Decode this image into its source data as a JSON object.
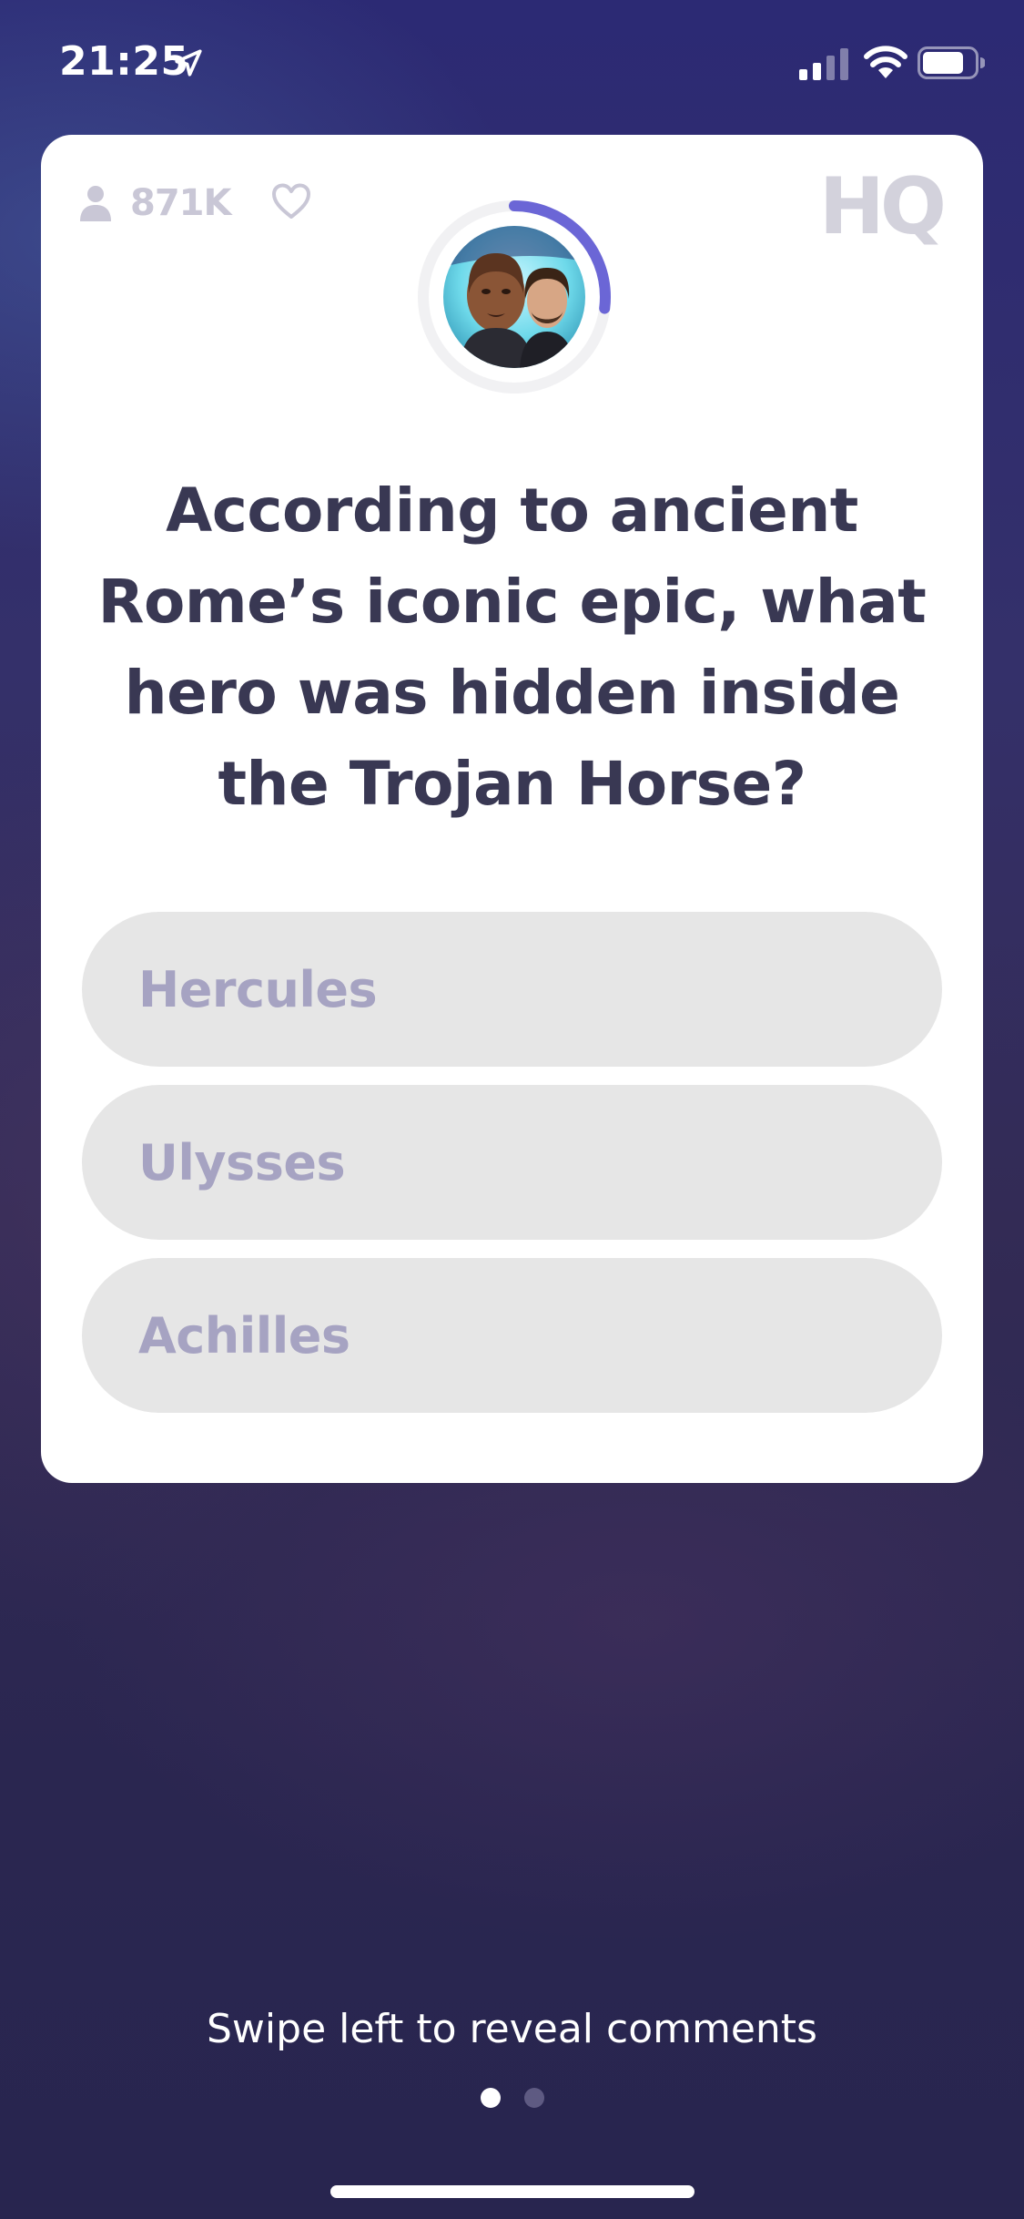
{
  "status_bar": {
    "time": "21:25",
    "icons": [
      "location-arrow-icon",
      "cellular-signal-icon",
      "wifi-icon",
      "battery-icon"
    ]
  },
  "card": {
    "viewer_count": "871K",
    "logo": "HQ",
    "icons": [
      "user-icon",
      "heart-icon"
    ],
    "countdown_progress": 0.27,
    "question": "According to ancient Rome’s iconic epic, what hero was hidden inside the Trojan Horse?",
    "answers": [
      {
        "label": "Hercules"
      },
      {
        "label": "Ulysses"
      },
      {
        "label": "Achilles"
      }
    ]
  },
  "footer": {
    "swipe_hint": "Swipe left to reveal comments",
    "pages": [
      {
        "active": true
      },
      {
        "active": false
      }
    ]
  },
  "colors": {
    "accent": "#6b66d6",
    "question_text": "#393853",
    "answer_bg": "#e6e6e6",
    "answer_text": "#a6a3c2",
    "muted_icon": "#c9c7d6",
    "dot_active": "#ffffff",
    "dot_inactive": "#5e5a82"
  }
}
